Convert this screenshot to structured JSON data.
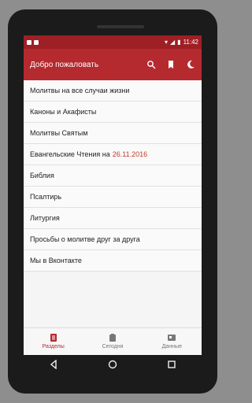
{
  "statusbar": {
    "time": "11:42"
  },
  "appbar": {
    "title": "Добро пожаловать"
  },
  "list": [
    {
      "label": "Молитвы на все случаи жизни"
    },
    {
      "label": "Каноны и Акафисты"
    },
    {
      "label": "Молитвы Святым"
    },
    {
      "label": "Евангельские Чтения на",
      "date": "26.11.2016"
    },
    {
      "label": "Библия"
    },
    {
      "label": "Псалтирь"
    },
    {
      "label": "Литургия"
    },
    {
      "label": "Просьбы о молитве друг за друга"
    },
    {
      "label": "Мы в Вконтакте"
    }
  ],
  "bottom_nav": {
    "sections": "Разделы",
    "today": "Сегодня",
    "data": "Данные"
  },
  "colors": {
    "accent": "#b52a2f",
    "date": "#c0392b"
  },
  "icons": [
    "search-icon",
    "bookmark-icon",
    "moon-icon",
    "back-icon",
    "home-icon",
    "recents-icon"
  ]
}
